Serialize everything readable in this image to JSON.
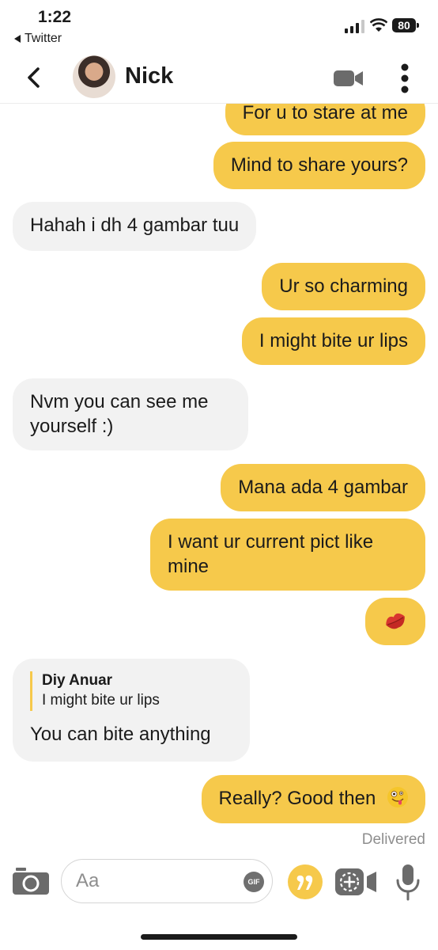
{
  "status_bar": {
    "time": "1:22",
    "back_app": "Twitter",
    "battery": "80"
  },
  "header": {
    "contact_name": "Nick"
  },
  "messages": [
    {
      "dir": "out",
      "text": "For u to stare at me"
    },
    {
      "dir": "out",
      "text": "Mind to share yours?"
    },
    {
      "dir": "in",
      "text": "Hahah i dh 4 gambar tuu"
    },
    {
      "dir": "out",
      "text": "Ur so charming"
    },
    {
      "dir": "out",
      "text": "I might bite ur lips"
    },
    {
      "dir": "in",
      "text": "Nvm you can see me yourself :)"
    },
    {
      "dir": "out",
      "text": "Mana ada 4 gambar"
    },
    {
      "dir": "out",
      "text": "I want ur current pict like mine"
    },
    {
      "dir": "out",
      "emoji": "kiss-mark"
    },
    {
      "dir": "in",
      "reply_author": "Diy Anuar",
      "reply_text": "I might bite ur lips",
      "text": "You can bite anything"
    },
    {
      "dir": "out",
      "text": "Really? Good then",
      "emoji": "zany-face"
    }
  ],
  "delivered": "Delivered",
  "composer": {
    "placeholder": "Aa",
    "gif_label": "GIF"
  },
  "colors": {
    "outgoing_bubble": "#f6c94b",
    "incoming_bubble": "#f2f2f2"
  },
  "icons": [
    "back-icon",
    "video-call-icon",
    "more-icon",
    "camera-icon",
    "gif-icon",
    "quote-icon",
    "add-video-icon",
    "mic-icon"
  ]
}
